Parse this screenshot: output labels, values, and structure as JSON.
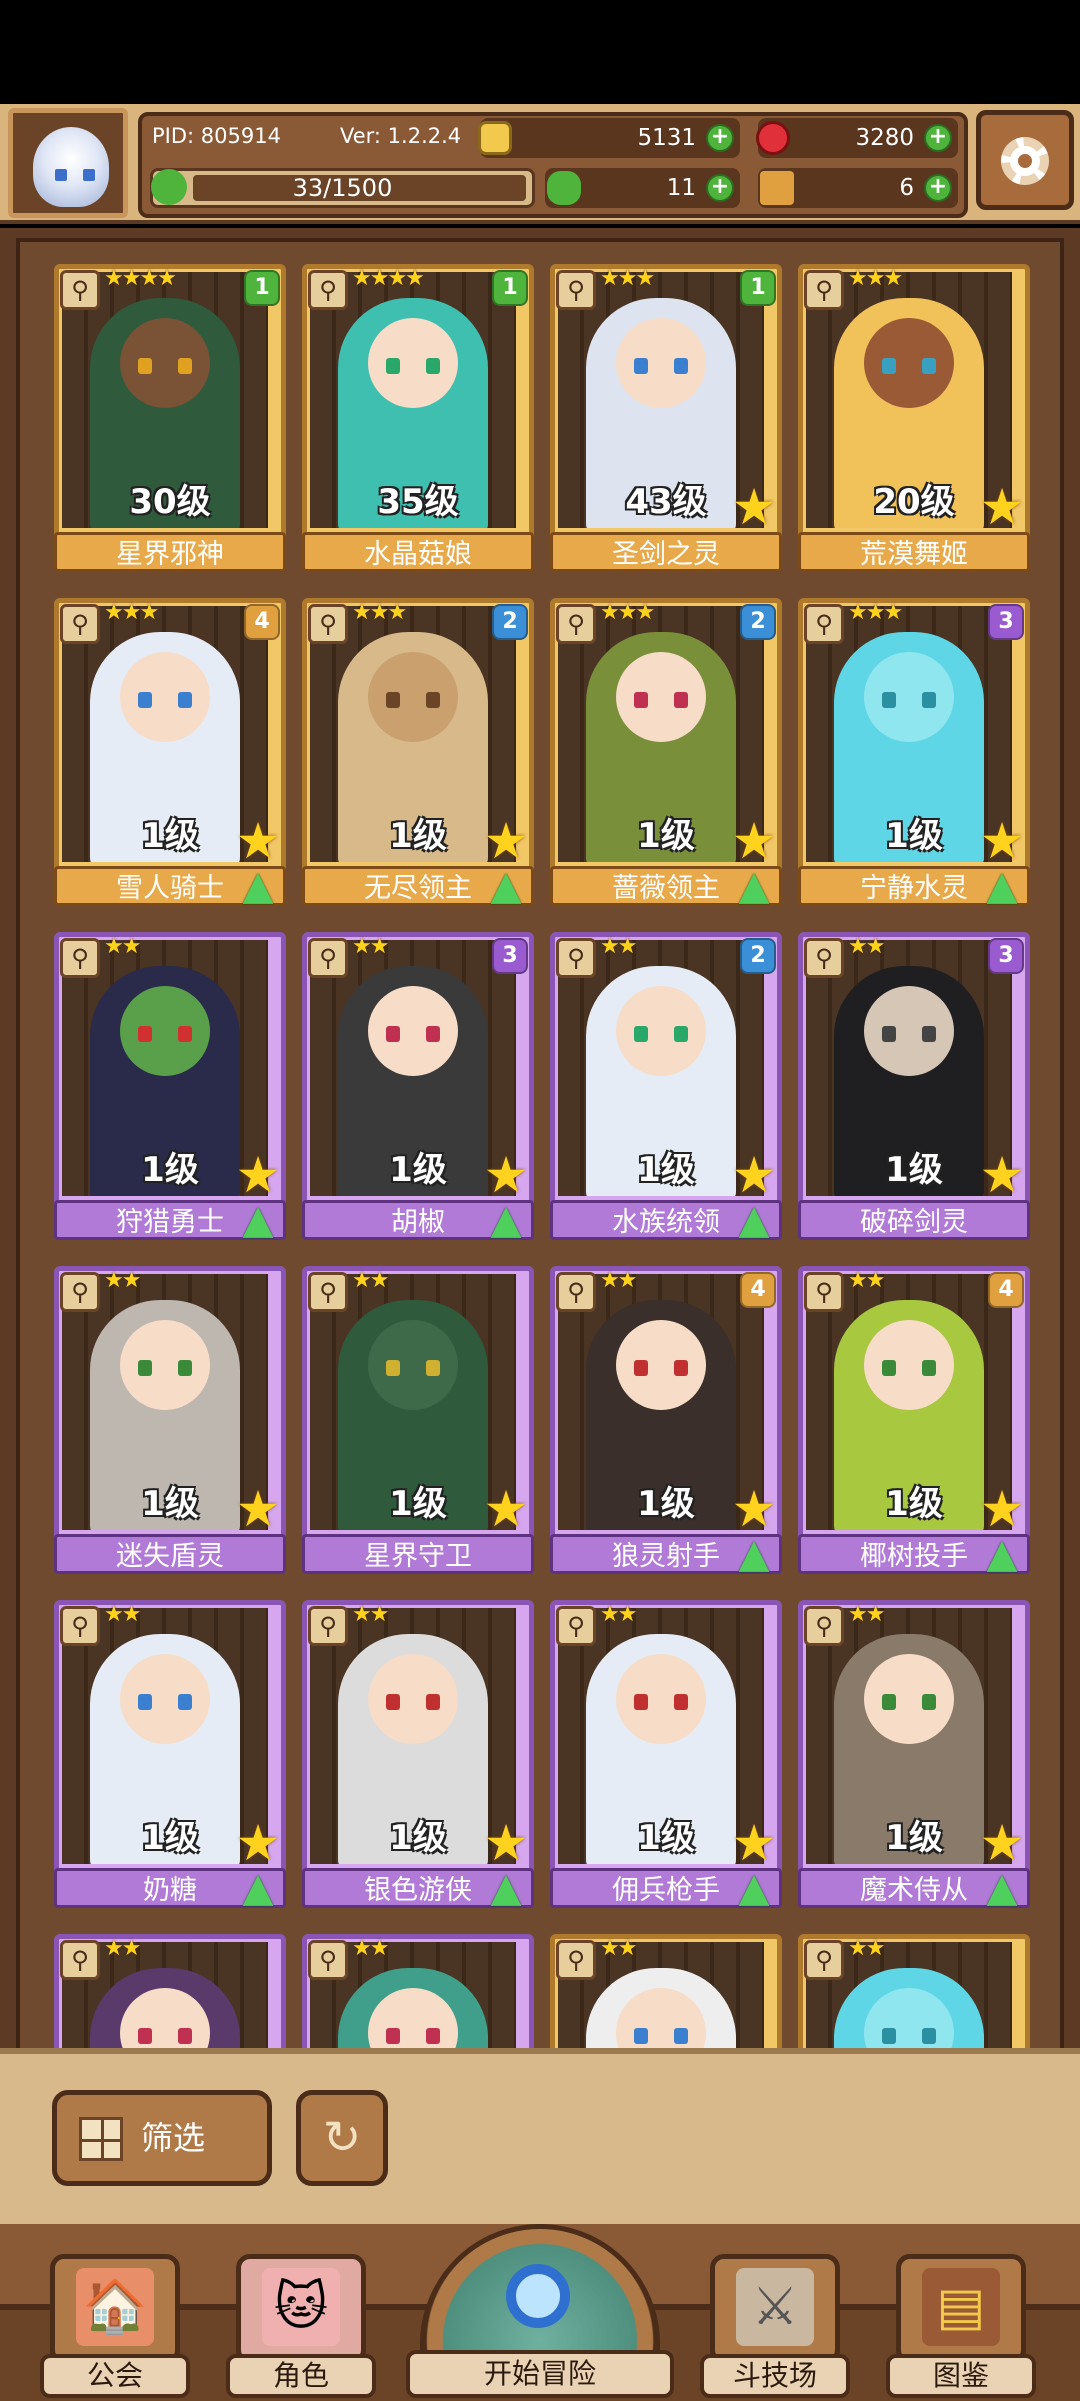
{
  "header": {
    "pid": "PID: 805914",
    "version": "Ver: 1.2.2.4",
    "energy": "33/1500",
    "gold": "5131",
    "gems": "3280",
    "clover": "11",
    "keys": "6"
  },
  "cards": [
    {
      "name": "星界邪神",
      "level": "30级",
      "stars": "★★★★",
      "badge": "1",
      "rarity": "gold",
      "hair": "#2f5a3c",
      "skin": "#7a5236",
      "eye": "#e0a020",
      "bigstar": false,
      "up": false
    },
    {
      "name": "水晶菇娘",
      "level": "35级",
      "stars": "★★★★",
      "badge": "1",
      "rarity": "gold",
      "hair": "#3fbfb0",
      "skin": "#f7dcc8",
      "eye": "#2aa86a",
      "bigstar": false,
      "up": false
    },
    {
      "name": "圣剑之灵",
      "level": "43级",
      "stars": "★★★",
      "badge": "1",
      "rarity": "gold",
      "hair": "#dde4f0",
      "skin": "#f7dcc8",
      "eye": "#3b7fd0",
      "bigstar": true,
      "up": false
    },
    {
      "name": "荒漠舞姬",
      "level": "20级",
      "stars": "★★★",
      "badge": "",
      "rarity": "gold",
      "hair": "#f2c25a",
      "skin": "#9a5a36",
      "eye": "#3aa0c0",
      "bigstar": true,
      "up": false
    },
    {
      "name": "雪人骑士",
      "level": "1级",
      "stars": "★★★",
      "badge": "4",
      "rarity": "gold",
      "hair": "#e6ecf6",
      "skin": "#f7dcc8",
      "eye": "#3b7fd0",
      "bigstar": true,
      "up": true
    },
    {
      "name": "无尽领主",
      "level": "1级",
      "stars": "★★★",
      "badge": "2",
      "rarity": "gold",
      "hair": "#d8b98a",
      "skin": "#c9a06e",
      "eye": "#6b4428",
      "bigstar": true,
      "up": true
    },
    {
      "name": "蔷薇领主",
      "level": "1级",
      "stars": "★★★",
      "badge": "2",
      "rarity": "gold",
      "hair": "#7a8f3a",
      "skin": "#f7dcc8",
      "eye": "#c03050",
      "bigstar": true,
      "up": true
    },
    {
      "name": "宁静水灵",
      "level": "1级",
      "stars": "★★★",
      "badge": "3",
      "rarity": "gold",
      "hair": "#5fd6e6",
      "skin": "#8fe6ef",
      "eye": "#2a8fa0",
      "bigstar": true,
      "up": true
    },
    {
      "name": "狩猎勇士",
      "level": "1级",
      "stars": "★★",
      "badge": "",
      "rarity": "purple",
      "hair": "#2a2a4a",
      "skin": "#5aa04a",
      "eye": "#d03030",
      "bigstar": true,
      "up": true
    },
    {
      "name": "胡椒",
      "level": "1级",
      "stars": "★★",
      "badge": "3",
      "rarity": "purple",
      "hair": "#3a3a3a",
      "skin": "#f7dcc8",
      "eye": "#c03050",
      "bigstar": true,
      "up": true
    },
    {
      "name": "水族统领",
      "level": "1级",
      "stars": "★★",
      "badge": "2",
      "rarity": "purple",
      "hair": "#e6ecf6",
      "skin": "#f7dcc8",
      "eye": "#2aa86a",
      "bigstar": true,
      "up": true
    },
    {
      "name": "破碎剑灵",
      "level": "1级",
      "stars": "★★",
      "badge": "3",
      "rarity": "purple",
      "hair": "#1f1f22",
      "skin": "#d6c6b6",
      "eye": "#444444",
      "bigstar": true,
      "up": false
    },
    {
      "name": "迷失盾灵",
      "level": "1级",
      "stars": "★★",
      "badge": "",
      "rarity": "purple",
      "hair": "#bdb7b0",
      "skin": "#f7dcc8",
      "eye": "#3a8a3a",
      "bigstar": true,
      "up": false
    },
    {
      "name": "星界守卫",
      "level": "1级",
      "stars": "★★",
      "badge": "",
      "rarity": "purple",
      "hair": "#2f5a3c",
      "skin": "#3f6a4a",
      "eye": "#d0b030",
      "bigstar": true,
      "up": false
    },
    {
      "name": "狼灵射手",
      "level": "1级",
      "stars": "★★",
      "badge": "4",
      "rarity": "purple",
      "hair": "#3a2f2a",
      "skin": "#f7dcc8",
      "eye": "#c03030",
      "bigstar": true,
      "up": true
    },
    {
      "name": "椰树投手",
      "level": "1级",
      "stars": "★★",
      "badge": "4",
      "rarity": "purple",
      "hair": "#a8c840",
      "skin": "#f7dcc8",
      "eye": "#3a8a3a",
      "bigstar": true,
      "up": true
    },
    {
      "name": "奶糖",
      "level": "1级",
      "stars": "★★",
      "badge": "",
      "rarity": "purple",
      "hair": "#e6ecf6",
      "skin": "#f7dcc8",
      "eye": "#3b7fd0",
      "bigstar": true,
      "up": true
    },
    {
      "name": "银色游侠",
      "level": "1级",
      "stars": "★★",
      "badge": "",
      "rarity": "purple",
      "hair": "#dcdcdc",
      "skin": "#f7dcc8",
      "eye": "#c03030",
      "bigstar": true,
      "up": true
    },
    {
      "name": "佣兵枪手",
      "level": "1级",
      "stars": "★★",
      "badge": "",
      "rarity": "purple",
      "hair": "#e6ecf6",
      "skin": "#f7dcc8",
      "eye": "#c03030",
      "bigstar": true,
      "up": true
    },
    {
      "name": "魔术侍从",
      "level": "1级",
      "stars": "★★",
      "badge": "",
      "rarity": "purple",
      "hair": "#8a7a6a",
      "skin": "#f7dcc8",
      "eye": "#3a8a3a",
      "bigstar": true,
      "up": true
    },
    {
      "name": "",
      "level": "",
      "stars": "★★",
      "badge": "",
      "rarity": "purple",
      "hair": "#5a3a6a",
      "skin": "#f7dcc8",
      "eye": "#c03050",
      "bigstar": false,
      "up": false
    },
    {
      "name": "",
      "level": "",
      "stars": "★★",
      "badge": "",
      "rarity": "purple",
      "hair": "#3f9f8a",
      "skin": "#f7dcc8",
      "eye": "#c03050",
      "bigstar": false,
      "up": false
    },
    {
      "name": "",
      "level": "",
      "stars": "★★",
      "badge": "",
      "rarity": "gold",
      "hair": "#eeeeee",
      "skin": "#f7dcc8",
      "eye": "#3b7fd0",
      "bigstar": false,
      "up": false
    },
    {
      "name": "",
      "level": "",
      "stars": "★★",
      "badge": "",
      "rarity": "gold",
      "hair": "#5fd6e6",
      "skin": "#8fe6ef",
      "eye": "#2a8fa0",
      "bigstar": false,
      "up": false
    }
  ],
  "controls": {
    "filter_label": "筛选"
  },
  "nav": {
    "guild": "公会",
    "character": "角色",
    "adventure": "开始冒险",
    "arena": "斗技场",
    "codex": "图鉴"
  },
  "colors": {
    "badge1": "#4fb43c",
    "badge2": "#3b8fd6",
    "badge3": "#9a5ad0",
    "badge4": "#e0a040"
  }
}
